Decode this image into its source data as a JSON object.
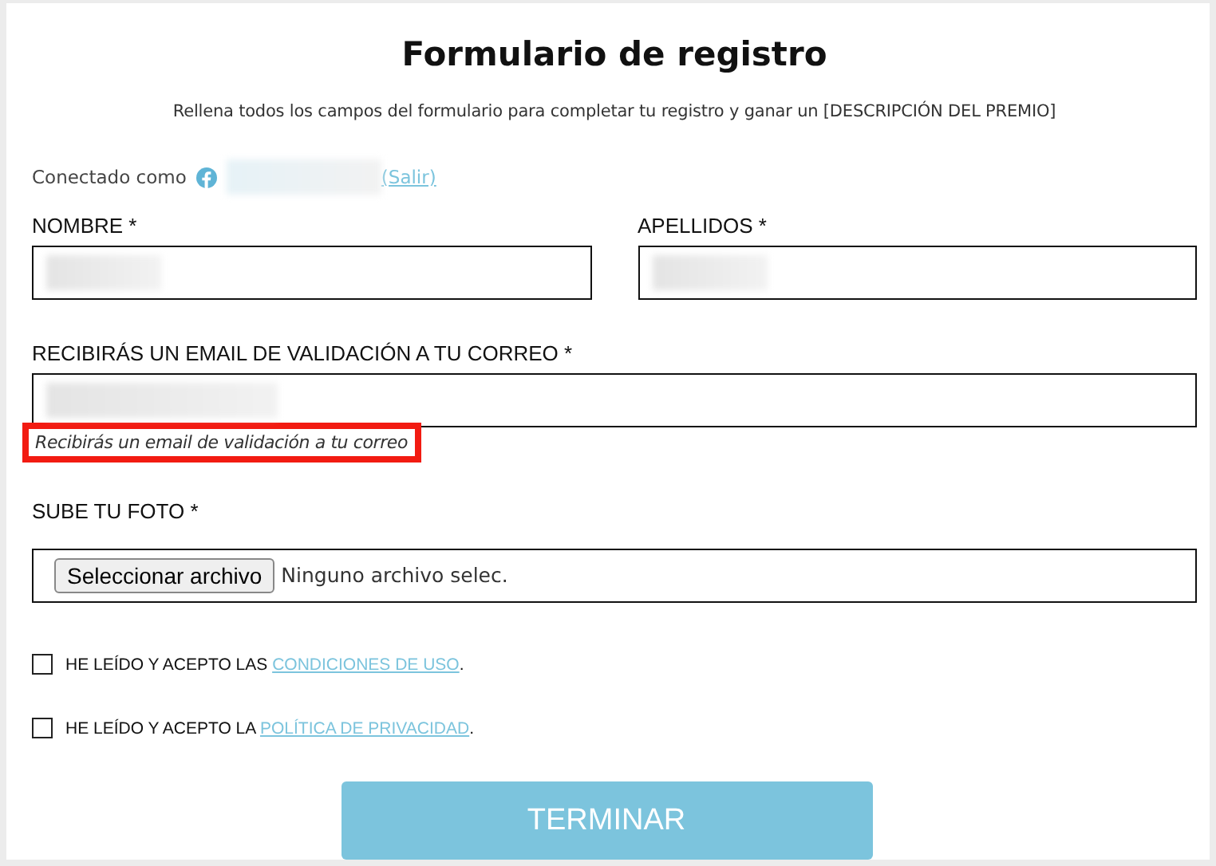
{
  "title": "Formulario de registro",
  "subtitle": "Rellena todos los campos del formulario para completar tu registro y ganar un [DESCRIPCIÓN DEL PREMIO]",
  "connected": {
    "label": "Conectado como",
    "name_blurred": true,
    "logout": "(Salir)"
  },
  "name_fields": [
    {
      "label": "NOMBRE *",
      "value_blurred": true
    },
    {
      "label": "APELLIDOS *",
      "value_blurred": true
    }
  ],
  "email_field": {
    "label": "RECIBIRÁS UN EMAIL DE VALIDACIÓN A TU CORREO *",
    "value_blurred": true,
    "hint": "Recibirás un email de validación a tu correo",
    "hint_highlighted": true
  },
  "photo_field": {
    "label": "SUBE TU FOTO *",
    "button": "Seleccionar archivo",
    "status": "Ninguno archivo selec."
  },
  "agreements": [
    {
      "text": "HE LEÍDO Y ACEPTO LAS ",
      "link": "CONDICIONES DE USO",
      "end": ".",
      "checked": false
    },
    {
      "text": "HE LEÍDO Y ACEPTO LA ",
      "link": "POLÍTICA DE PRIVACIDAD",
      "end": ".",
      "checked": false
    }
  ],
  "submit": "TERMINAR"
}
